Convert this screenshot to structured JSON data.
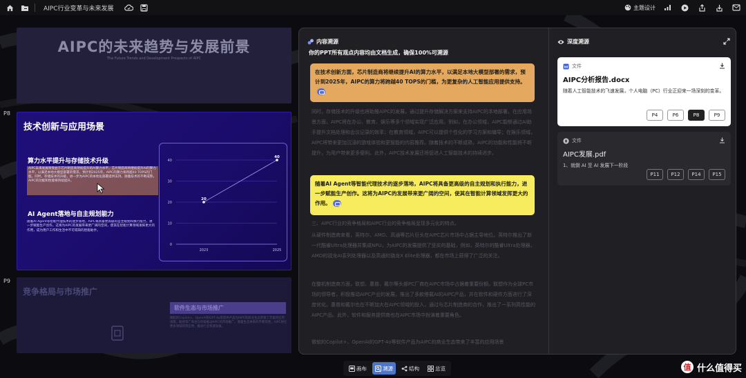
{
  "topbar": {
    "doc_title": "AIPC行业变革与未来发展",
    "theme_label": "主题设计",
    "icons": [
      "home-icon",
      "folder-icon",
      "cloud-icon",
      "save-icon",
      "palette-icon",
      "chart-icon",
      "play-icon",
      "share-icon",
      "download-icon",
      "mail-icon"
    ]
  },
  "slides": {
    "top": {
      "title": "AIPC的未来趋势与发展前景",
      "subtitle": "The Future Trends and Development Prospects of AIPC"
    },
    "main": {
      "page": "P8",
      "title": "技术创新与应用场景",
      "section1_title": "算力水平提升与存储技术升级",
      "section1_text": "AIPC未来发展将受益于芯片制造商持续提升的AI算力水平，芯片制造商将继续提升AI的算力水平，以满足本地大模型部署的需求。预计到2025年，AIPC的算力将跨越40 TOPS的门槛。同时，存储技术的升级，进一步为AIPC的本地化部署提供支持。随着技术的不断成熟，AIPC的功能和性能将持续提升。",
      "section2_title": "AI Agent落地与自主规划能力",
      "section2_text": "随着AI Agent等智能代理技术的逐步落地，AIPC将具备更高级的自主规划和执行能力，进一步赋能生产创作。这将为AIPC的发展带来更广阔的空间，使其在智能计算领域发挥更大的作用，成为用户工作和生活中不可或缺的智能助手。",
      "chart": {
        "cursor_icon": "cursor-icon"
      }
    },
    "bottom": {
      "page": "P9",
      "title": "竞争格局与市场推广",
      "tag": "软件生态与市场推广",
      "text": "微软的Copilot+、OpenAI的GPT-4o等软件产品为AIPC的商业生态带来了丰富的应用场景，联想等厂商也在积极推动AIPC的市场推广。随着生态体系的不断完善，AIPC将在更多领域得到应用，推动行业快速发展。"
    }
  },
  "chart_data": {
    "type": "line",
    "x": [
      "2023",
      "2025"
    ],
    "series": [
      {
        "values": [
          20,
          40
        ]
      }
    ],
    "data_labels": [
      "20",
      "40"
    ],
    "ylim": [
      0,
      40
    ],
    "yticks": [
      0,
      10,
      20,
      30,
      40
    ],
    "grid": true,
    "title": "",
    "xlabel": "",
    "ylabel": ""
  },
  "source_panel": {
    "title": "内容溯源",
    "subtitle": "你的PPT所有观点内容均由文档生成，确保100%可溯源",
    "highlight1": "在技术创新方面，芯片制造商将继续提升AI的算力水平，以满足本地大模型部署的需求，预计到2025年，AIPC的算力将跨越40 TOPS的门槛，为更复杂的人工智能应用提供支持。",
    "dim1": "同时，存储技术的升级也将助推AIPC的发展，通过提升存储解决方案来支持AIPC的本地部署。在应用场景方面，AIPC将在办公、教育、娱乐等多个领域实现广泛应用。例如，在办公领域，AIPC能够通过AI助手提升文档处理和会议记录的效率；在教育领域，AIPC可以提供个性化的学习方案和辅导；在娱乐领域，AIPC将带来更加沉浸的游戏体验和更智能的内容推荐。随着技术的不断成熟，AIPC的功能和性能将不断提升，为用户带来更多便利。此外，AIPC技术发展还将促进人工智能技术的持续进步。",
    "highlight2": "随着AI Agent等智能代理技术的逐步落地，AIPC将具备更高级的自主规划和执行能力，进一步赋能生产创作。这将为AIPC的发展带来更广阔的空间，使其在智能计算领域发挥更大的作用。",
    "dim2": "三、AIPC行业的竞争格局和AIPC行业的竞争格局呈现多元化的特点。",
    "dim3": "从硬件制造商来看，英特尔、AMD、高通等芯片巨头在AIPC芯片市场中占据主导地位。英特尔推出了新一代酷睿Ultra处理器并集成NPU，为AIPC的发展提供了坚实的基础，例如，英特尔的酷睿Ultra处理器，AMD的锐龙AI系列处理器以及高通的骁龙X Elite处理器，都在市场上获得了广泛的关注。",
    "dim4": "在整机制造商方面，联想、惠普、戴尔等头部PC厂商在AIPC市场中占据着重要份额。联想作为全球PC市场的领导者，积极推动AIPC产业的发展，推出了多款搭载AI的AIPC产品，并在软件和硬件方面进行了深度优化。惠普和戴尔也在不断加大在AIPC领域的投入，通过与芯片制造商的合作，推出了一系列高性能的AIPC产品。此外，软件和服务提供商也在AIPC市场中扮演着重要角色。",
    "dim5": "微软的Copilot+、OpenAI的GPT-4o等软件产品为AIPC的商业生态带来了丰富的应用场景"
  },
  "deep_panel": {
    "title": "深度溯源",
    "card1": {
      "tag": "文件",
      "name": "AIPC分析报告.docx",
      "desc": "随着人工智能技术的飞速发展，个人电脑（PC）行业正迎来一场深刻的变革。",
      "pages": [
        "P4",
        "P6",
        "P8",
        "P9"
      ],
      "active": "P8"
    },
    "card2": {
      "tag": "文件",
      "name": "AIPC发展.pdf",
      "desc": "1、就倒 AI 至 AI 发展下一阶段",
      "pages": [
        "P11",
        "P12",
        "P14",
        "P15"
      ]
    }
  },
  "bottombar": {
    "items": [
      "画布",
      "溯源",
      "结构",
      "总览"
    ],
    "active": "溯源"
  },
  "watermark": "什么值得买"
}
